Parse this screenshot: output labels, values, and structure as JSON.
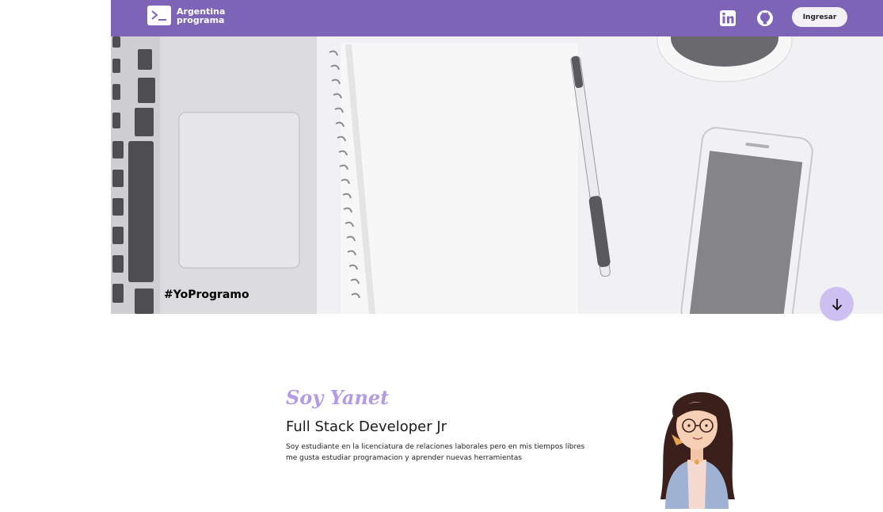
{
  "navbar": {
    "brand_line1": "Argentina",
    "brand_line2": "programa",
    "login_label": "Ingresar",
    "icons": [
      "linkedin-icon",
      "github-icon"
    ],
    "bg_color": "#7e64b6"
  },
  "hero": {
    "hashtag": "#YoProgramo"
  },
  "about": {
    "greeting": "Soy Yanet",
    "role": "Full Stack Developer Jr",
    "description": "Soy estudiante en la licenciatura de relaciones laborales pero en mis tiempos libres me gusta estudiar programacion y aprender nuevas herramientas",
    "accent_color": "#b49be6"
  }
}
